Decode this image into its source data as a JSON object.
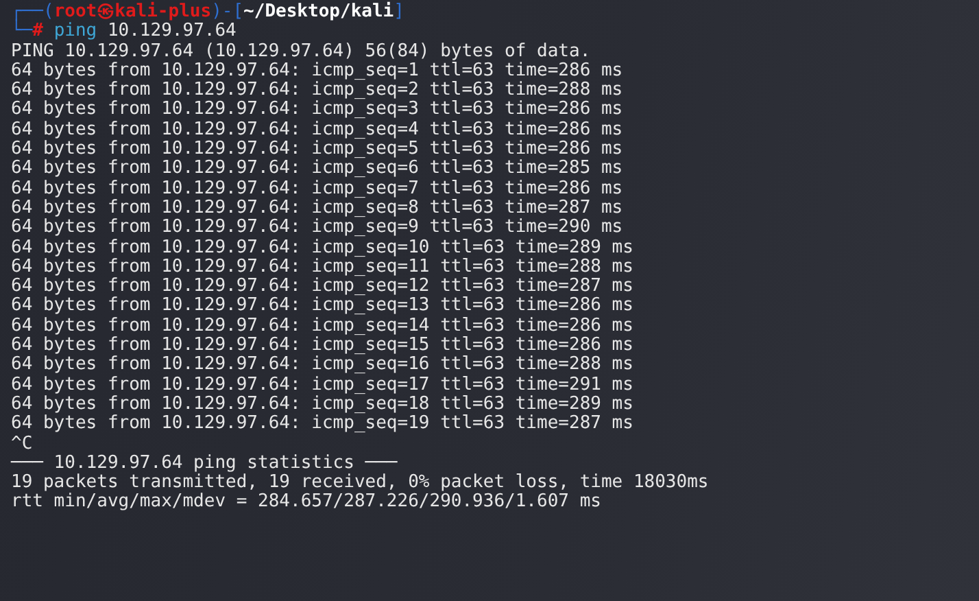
{
  "prompt": {
    "lines": [
      [
        {
          "kind": "frame",
          "text": "┌──("
        },
        {
          "kind": "user",
          "text": "root㉿kali-plus"
        },
        {
          "kind": "frame",
          "text": ")-["
        },
        {
          "kind": "path",
          "text": "~/Desktop/kali"
        },
        {
          "kind": "frame",
          "text": "]"
        }
      ],
      [
        {
          "kind": "frame",
          "text": "└─"
        },
        {
          "kind": "user",
          "text": "# "
        },
        {
          "kind": "command",
          "text": "ping"
        },
        {
          "kind": "text",
          "text": " 10.129.97.64"
        }
      ]
    ]
  },
  "output": [
    "PING 10.129.97.64 (10.129.97.64) 56(84) bytes of data.",
    "64 bytes from 10.129.97.64: icmp_seq=1 ttl=63 time=286 ms",
    "64 bytes from 10.129.97.64: icmp_seq=2 ttl=63 time=288 ms",
    "64 bytes from 10.129.97.64: icmp_seq=3 ttl=63 time=286 ms",
    "64 bytes from 10.129.97.64: icmp_seq=4 ttl=63 time=286 ms",
    "64 bytes from 10.129.97.64: icmp_seq=5 ttl=63 time=286 ms",
    "64 bytes from 10.129.97.64: icmp_seq=6 ttl=63 time=285 ms",
    "64 bytes from 10.129.97.64: icmp_seq=7 ttl=63 time=286 ms",
    "64 bytes from 10.129.97.64: icmp_seq=8 ttl=63 time=287 ms",
    "64 bytes from 10.129.97.64: icmp_seq=9 ttl=63 time=290 ms",
    "64 bytes from 10.129.97.64: icmp_seq=10 ttl=63 time=289 ms",
    "64 bytes from 10.129.97.64: icmp_seq=11 ttl=63 time=288 ms",
    "64 bytes from 10.129.97.64: icmp_seq=12 ttl=63 time=287 ms",
    "64 bytes from 10.129.97.64: icmp_seq=13 ttl=63 time=286 ms",
    "64 bytes from 10.129.97.64: icmp_seq=14 ttl=63 time=286 ms",
    "64 bytes from 10.129.97.64: icmp_seq=15 ttl=63 time=286 ms",
    "64 bytes from 10.129.97.64: icmp_seq=16 ttl=63 time=288 ms",
    "64 bytes from 10.129.97.64: icmp_seq=17 ttl=63 time=291 ms",
    "64 bytes from 10.129.97.64: icmp_seq=18 ttl=63 time=289 ms",
    "64 bytes from 10.129.97.64: icmp_seq=19 ttl=63 time=287 ms",
    "^C",
    "─── 10.129.97.64 ping statistics ───",
    "19 packets transmitted, 19 received, 0% packet loss, time 18030ms",
    "rtt min/avg/max/mdev = 284.657/287.226/290.936/1.607 ms"
  ]
}
